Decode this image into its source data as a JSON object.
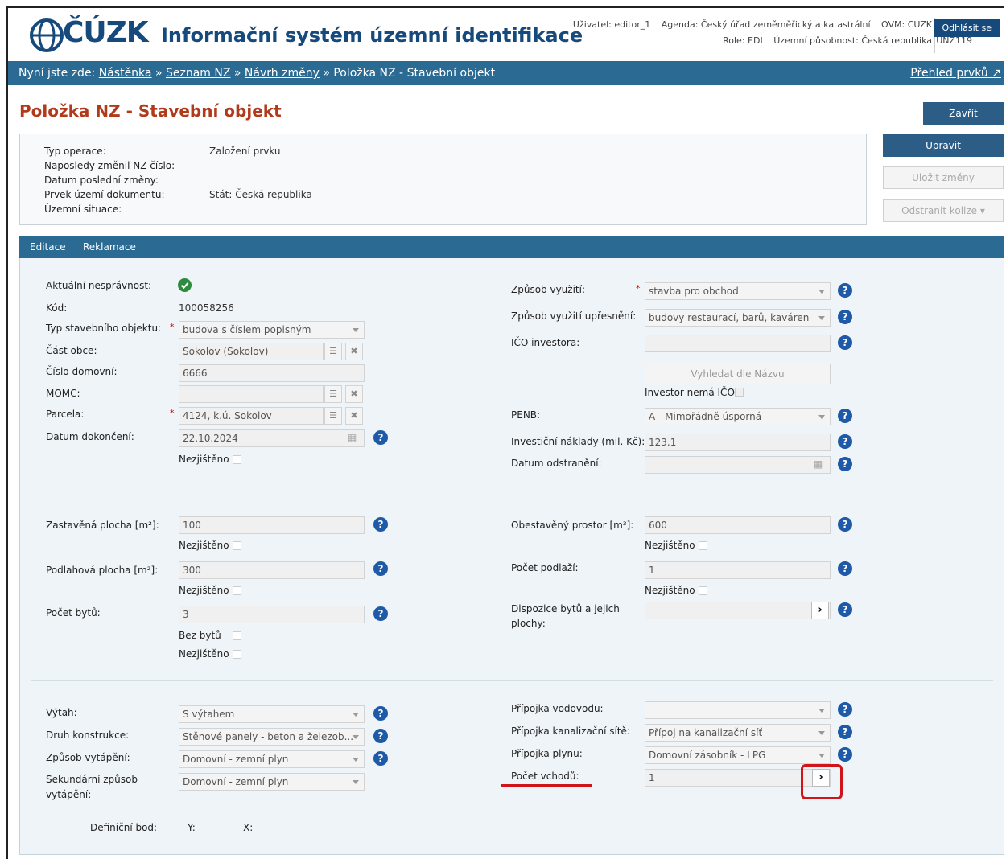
{
  "header": {
    "logo": "ČÚZK",
    "title": "Informační systém územní identifikace",
    "user": "Uživatel: editor_1",
    "agenda": "Agenda: Český úřad zeměměřický a katastrální",
    "ovm": "OVM: CUZK",
    "role": "Role: EDI",
    "territory": "Územní působnost: Česká republika",
    "unz": "UNZ119",
    "logout": "Odhlásit se"
  },
  "breadcrumb": {
    "prefix": "Nyní jste zde:",
    "items": [
      "Nástěnka",
      "Seznam NZ",
      "Návrh změny"
    ],
    "separator": "»",
    "current": "Položka NZ - Stavební objekt",
    "right_link": "Přehled prvků"
  },
  "page": {
    "title": "Položka NZ - Stavební objekt"
  },
  "actions": {
    "close": "Zavřít",
    "edit": "Upravit",
    "save": "Uložit změny",
    "remove_collisions": "Odstranit kolize"
  },
  "info": {
    "labels": [
      "Typ operace:",
      "Naposledy změnil NZ číslo:",
      "Datum poslední změny:",
      "Prvek území dokumentu:",
      "Územní situace:"
    ],
    "values": [
      "Založení prvku",
      "",
      "",
      "Stát: Česká republika",
      ""
    ]
  },
  "tabs": [
    "Editace",
    "Reklamace"
  ],
  "left": {
    "aktualni_nespravnost": "Aktuální nesprávnost:",
    "kod_label": "Kód:",
    "kod_value": "100058256",
    "typ_label": "Typ stavebního objektu:",
    "typ_value": "budova s číslem popisným",
    "cast_obce_label": "Část obce:",
    "cast_obce_value": "Sokolov (Sokolov)",
    "cislo_domovni_label": "Číslo domovní:",
    "cislo_domovni_value": "6666",
    "momc_label": "MOMC:",
    "momc_value": "",
    "parcela_label": "Parcela:",
    "parcela_value": "4124, k.ú. Sokolov",
    "datum_dokonceni_label": "Datum dokončení:",
    "datum_dokonceni_value": "22.10.2024",
    "nezjisteno": "Nezjištěno",
    "zastavena_label": "Zastavěná plocha [m²]:",
    "zastavena_value": "100",
    "podlahova_label": "Podlahová plocha [m²]:",
    "podlahova_value": "300",
    "pocet_bytu_label": "Počet bytů:",
    "pocet_bytu_value": "3",
    "bez_bytu": "Bez bytů",
    "vytah_label": "Výtah:",
    "vytah_value": "S výtahem",
    "druh_label": "Druh konstrukce:",
    "druh_value": "Stěnové panely - beton a železob...",
    "vytapeni_label": "Způsob vytápění:",
    "vytapeni_value": "Domovní - zemní plyn",
    "sek_label_1": "Sekundární způsob",
    "sek_label_2": "vytápění:",
    "sek_value": "Domovní - zemní plyn",
    "def_bod": "Definiční bod:",
    "def_y": "Y:  -",
    "def_x": "X:  -"
  },
  "right": {
    "zpusob_label": "Způsob využití:",
    "zpusob_value": "stavba pro obchod",
    "upresneni_label": "Způsob využití upřesnění:",
    "upresneni_value": "budovy restaurací, barů, kaváren",
    "ico_label": "IČO investora:",
    "ico_value": "",
    "vyhledat": "Vyhledat dle Názvu",
    "investor_nema": "Investor nemá IČO",
    "penb_label": "PENB:",
    "penb_value": "A - Mimořádně úsporná",
    "naklady_label": "Investiční náklady (mil. Kč):",
    "naklady_value": "123.1",
    "odstraneni_label": "Datum odstranění:",
    "odstraneni_value": "",
    "obestaveny_label": "Obestavěný prostor [m³]:",
    "obestaveny_value": "600",
    "podlazi_label": "Počet podlaží:",
    "podlazi_value": "1",
    "dispozice_label_1": "Dispozice bytů a jejich",
    "dispozice_label_2": "plochy:",
    "dispozice_value": "",
    "vodovod_label": "Přípojka vodovodu:",
    "vodovod_value": "",
    "kanalizace_label": "Přípojka kanalizační sítě:",
    "kanalizace_value": "Přípoj na kanalizační síť",
    "plyn_label": "Přípojka plynu:",
    "plyn_value": "Domovní zásobník - LPG",
    "vchody_label": "Počet vchodů:",
    "vchody_value": "1"
  },
  "colors": {
    "brand": "#174a7c",
    "bar": "#2b6a93",
    "title": "#b03a1a",
    "highlight": "#d0141a",
    "help": "#1e5aa8",
    "ok": "#2e8b3e"
  }
}
